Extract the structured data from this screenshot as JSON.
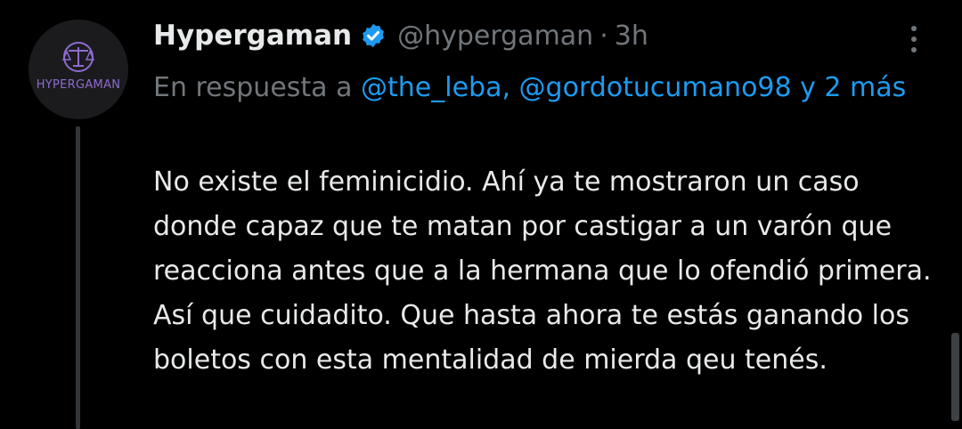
{
  "tweet": {
    "avatar_text": "HYPERGAMAN",
    "display_name": "Hypergaman",
    "handle": "@hypergaman",
    "separator": "·",
    "time": "3h",
    "reply_prefix": "En respuesta a",
    "reply_mentions": "@the_leba, @gordotucumano98",
    "reply_suffix": "y 2 más",
    "text": "No existe el feminicidio. Ahí ya te mostraron un caso donde capaz que te matan por castigar a un varón que reacciona antes que a la hermana que lo ofendió primera. Así que cuidadito. Que hasta ahora te estás ganando los boletos con esta mentalidad de mierda qeu tenés."
  },
  "colors": {
    "background": "#000000",
    "primary_text": "#e7e9ea",
    "secondary_text": "#71767b",
    "link": "#1d9bf0",
    "avatar_accent": "#8d6bd1"
  },
  "icons": {
    "verified": "verified-badge-icon",
    "more": "more-vertical-icon",
    "avatar_emblem": "scales-icon"
  }
}
